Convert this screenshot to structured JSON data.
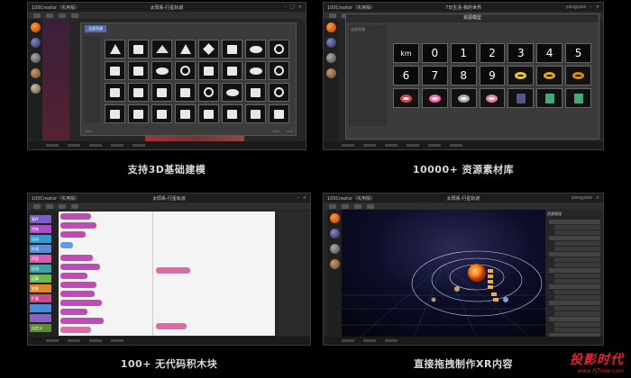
{
  "panels": [
    {
      "title_left": "100Creator（实用版）",
      "title_center": "太阳系-行星轨道",
      "title_right": "",
      "dialog_title": "",
      "tabs": [
        "全部资源",
        "",
        "",
        "",
        "",
        "",
        ""
      ]
    },
    {
      "title_left": "100Creator（实用版）",
      "title_center": "7日生活-我的世界",
      "title_right": "yangyaoi",
      "dialog_title": "资源模型",
      "side": [
        "全部资源"
      ]
    },
    {
      "title_left": "100Creator（实用版）",
      "title_center": "太阳系-行星轨道",
      "title_right": ""
    },
    {
      "title_left": "100Creator（实用版）",
      "title_center": "太阳系-行星轨道",
      "title_right": "yangyaoi",
      "sidebar_title": "资源管理"
    }
  ],
  "keypad": [
    "km",
    "0",
    "1",
    "2",
    "3",
    "4",
    "5",
    "6",
    "7",
    "8",
    "9"
  ],
  "block_categories": [
    "事件",
    "控制",
    "运动",
    "外观",
    "声音",
    "侦测",
    "运算",
    "变量",
    "扩展",
    "",
    "",
    "自定义"
  ],
  "captions": [
    "支持3D基础建模",
    "10000+ 资源素材库",
    "100+ 无代码积木块",
    "直接拖拽制作XR内容"
  ],
  "logo": {
    "cn": "投影时代",
    "en": "www.PjTime.com"
  },
  "colors": {
    "accent": "#4a6ea8",
    "block_purple": "#c14bb5",
    "block_pink": "#e06aa8",
    "category_colors": [
      "#7b5fc7",
      "#a64fc4",
      "#2f9bd6",
      "#5b8bd9",
      "#d65bb0",
      "#3fa0a0",
      "#6cb84a",
      "#d98a2e",
      "#c94a8a",
      "#4a8ad9",
      "#8a5fc7",
      "#5f8a3a"
    ]
  }
}
